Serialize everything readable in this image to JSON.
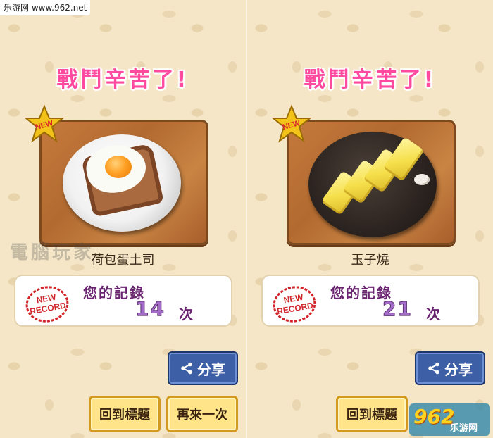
{
  "watermark": {
    "site_text": "乐游网 www.962.net",
    "corner_big": "962",
    "corner_small": "乐游网",
    "mid_text": "電腦玩家"
  },
  "panels": [
    {
      "title": "戰鬥辛苦了!",
      "badge": "NEW",
      "dish_name": "荷包蛋土司",
      "stamp_text": [
        "NEW",
        "RECORD"
      ],
      "record_label": "您的記錄",
      "record_count": "14",
      "record_unit": "次",
      "share_label": "分享",
      "back_label": "回到標題",
      "again_label": "再來一次"
    },
    {
      "title": "戰鬥辛苦了!",
      "badge": "NEW",
      "dish_name": "玉子燒",
      "stamp_text": [
        "NEW",
        "RECORD"
      ],
      "record_label": "您的記錄",
      "record_count": "21",
      "record_unit": "次",
      "share_label": "分享",
      "back_label": "回到標題"
    }
  ],
  "colors": {
    "title": "#ff4aa0",
    "share_bg": "#3c5fa5",
    "button_bg": "#ffe48a",
    "record_text": "#6a2570",
    "count": "#a36cc9"
  },
  "icons": [
    "share-icon",
    "sheriff-star-icon",
    "new-record-stamp-icon"
  ]
}
